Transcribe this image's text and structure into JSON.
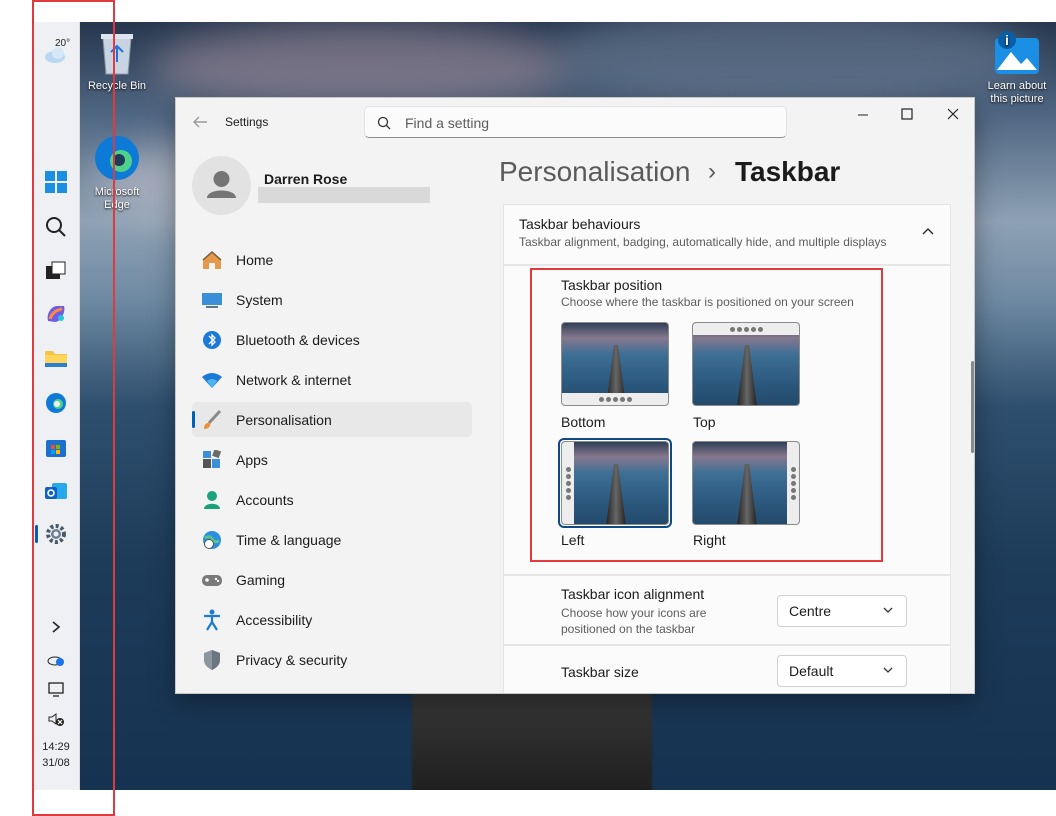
{
  "taskbar": {
    "weather_temp": "20°",
    "time": "14:29",
    "date": "31/08"
  },
  "desktop": {
    "recycle_bin": "Recycle Bin",
    "edge": "Microsoft Edge",
    "learn": "Learn about this picture"
  },
  "window": {
    "app_title": "Settings",
    "search_placeholder": "Find a setting",
    "user": {
      "name": "Darren Rose"
    },
    "breadcrumb": {
      "parent": "Personalisation",
      "separator": "›",
      "current": "Taskbar"
    },
    "nav": [
      {
        "label": "Home"
      },
      {
        "label": "System"
      },
      {
        "label": "Bluetooth & devices"
      },
      {
        "label": "Network & internet"
      },
      {
        "label": "Personalisation"
      },
      {
        "label": "Apps"
      },
      {
        "label": "Accounts"
      },
      {
        "label": "Time & language"
      },
      {
        "label": "Gaming"
      },
      {
        "label": "Accessibility"
      },
      {
        "label": "Privacy & security"
      }
    ],
    "behaviours": {
      "title": "Taskbar behaviours",
      "subtitle": "Taskbar alignment, badging, automatically hide, and multiple displays"
    },
    "position": {
      "title": "Taskbar position",
      "subtitle": "Choose where the taskbar is positioned on your screen",
      "options": [
        {
          "label": "Bottom"
        },
        {
          "label": "Top"
        },
        {
          "label": "Left",
          "selected": true
        },
        {
          "label": "Right"
        }
      ]
    },
    "alignment": {
      "title": "Taskbar icon alignment",
      "subtitle": "Choose how your icons are positioned on the taskbar",
      "value": "Centre"
    },
    "size": {
      "title": "Taskbar size",
      "value": "Default"
    }
  },
  "colors": {
    "accent": "#005fb8",
    "highlight": "#e0393e"
  }
}
